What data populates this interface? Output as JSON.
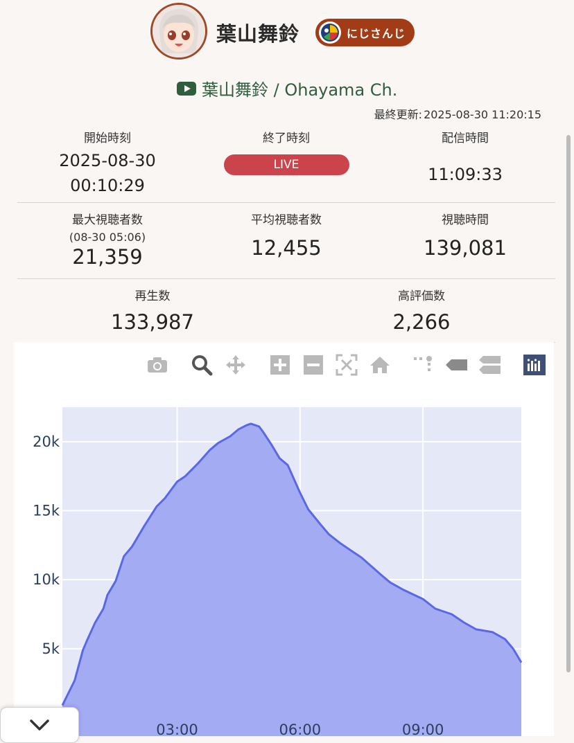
{
  "header": {
    "vtuber_name": "葉山舞鈴",
    "org_badge": "にじさんじ",
    "channel_name": "葉山舞鈴 / Ohayama Ch.",
    "updated_label": "最終更新:",
    "updated_value": "2025-08-30 11:20:15"
  },
  "stats": {
    "start_label": "開始時刻",
    "start_date": "2025-08-30",
    "start_time": "00:10:29",
    "end_label": "終了時刻",
    "end_value": "LIVE",
    "duration_label": "配信時間",
    "duration_value": "11:09:33",
    "peak_label": "最大視聴者数",
    "peak_time": "(08-30 05:06)",
    "peak_value": "21,359",
    "avg_label": "平均視聴者数",
    "avg_value": "12,455",
    "watch_label": "視聴時間",
    "watch_value": "139,081",
    "views_label": "再生数",
    "views_value": "133,987",
    "likes_label": "高評価数",
    "likes_value": "2,266"
  },
  "modebar_icons": [
    "camera-icon",
    "zoom-icon",
    "pan-icon",
    "zoom-in-icon",
    "zoom-out-icon",
    "autoscale-icon",
    "reset-axes-icon",
    "spike-lines-icon",
    "hover-closest-icon",
    "hover-compare-icon",
    "plotly-logo-icon"
  ],
  "colors": {
    "accent": "#a23c16",
    "live": "#cc444b",
    "channel": "#2f5d3d",
    "series_line": "#5a68e8",
    "series_fill": "#a3abf3",
    "plot_bg": "#e5e9f7"
  },
  "chart_data": {
    "type": "area",
    "x_unit": "hours since 00:00",
    "x_ticks": [
      "03:00",
      "06:00",
      "09:00"
    ],
    "x_tick_values": [
      3,
      6,
      9
    ],
    "y_ticks": [
      "5k",
      "10k",
      "15k",
      "20k"
    ],
    "y_tick_values": [
      5000,
      10000,
      15000,
      20000
    ],
    "xlim": [
      0.2,
      11.4
    ],
    "ylim": [
      0,
      22500
    ],
    "series": [
      {
        "x": [
          0.2,
          0.5,
          0.7,
          0.8,
          1.0,
          1.2,
          1.3,
          1.5,
          1.7,
          1.9,
          2.2,
          2.5,
          2.7,
          3.0,
          3.2,
          3.5,
          3.8,
          4.0,
          4.3,
          4.5,
          4.7,
          4.8,
          5.0,
          5.1,
          5.3,
          5.5,
          5.7,
          6.0,
          6.2,
          6.5,
          6.7,
          7.0,
          7.2,
          7.5,
          8.0,
          8.2,
          8.5,
          9.0,
          9.3,
          9.7,
          10.0,
          10.3,
          10.5,
          10.7,
          11.0,
          11.2,
          11.4
        ],
        "y": [
          900,
          2700,
          4900,
          5600,
          6900,
          7900,
          8900,
          9900,
          11700,
          12400,
          13900,
          15300,
          15900,
          17100,
          17500,
          18400,
          19400,
          19900,
          20400,
          20900,
          21200,
          21300,
          21100,
          20700,
          19800,
          18800,
          18300,
          16300,
          15100,
          14000,
          13300,
          12600,
          12200,
          11600,
          10300,
          9800,
          9300,
          8600,
          7900,
          7500,
          6900,
          6400,
          6300,
          6200,
          5700,
          5000,
          4000
        ]
      }
    ]
  }
}
